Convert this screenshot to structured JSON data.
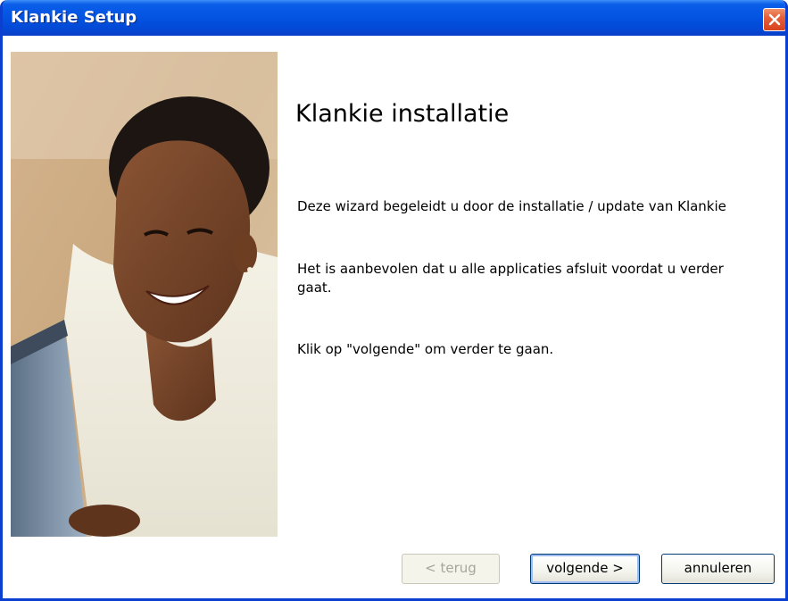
{
  "window": {
    "title": "Klankie Setup",
    "close_icon": "close-icon"
  },
  "wizard": {
    "heading": "Klankie installatie",
    "paragraph_1": "Deze wizard begeleidt u door de installatie / update van Klankie",
    "paragraph_2": "Het is aanbevolen dat u alle applicaties afsluit voordat u verder gaat.",
    "paragraph_3": "Klik op \"volgende\" om verder te gaan.",
    "side_image": "smiling-woman-at-computer-photo"
  },
  "buttons": {
    "back_label": "< terug",
    "back_enabled": false,
    "next_label": "volgende >",
    "cancel_label": "annuleren"
  },
  "colors": {
    "titlebar": "#0355e2",
    "close_button": "#d9431e",
    "focus_ring": "#9dbbf0"
  }
}
